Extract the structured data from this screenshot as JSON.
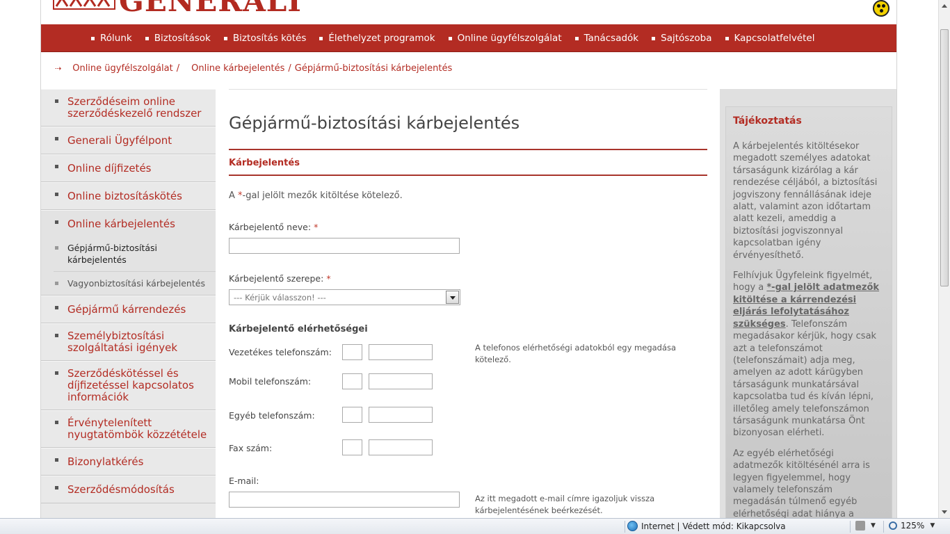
{
  "header": {
    "logo_text": "GENERALI",
    "accessibility_icon": "accessibility-icon"
  },
  "topnav": {
    "items": [
      {
        "label": "Rólunk"
      },
      {
        "label": "Biztosítások"
      },
      {
        "label": "Biztosítás kötés"
      },
      {
        "label": "Élethelyzet programok"
      },
      {
        "label": "Online ügyfélszolgálat"
      },
      {
        "label": "Tanácsadók"
      },
      {
        "label": "Sajtószoba"
      },
      {
        "label": "Kapcsolatfelvétel"
      }
    ]
  },
  "breadcrumb": {
    "items": [
      "Online ügyfélszolgálat",
      "Online kárbejelentés",
      "Gépjármű-biztosítási kárbejelentés"
    ],
    "sep": "/"
  },
  "sidebar": {
    "items": [
      {
        "label": "Szerződéseim online szerződéskezelő rendszer"
      },
      {
        "label": "Generali Ügyfélpont"
      },
      {
        "label": "Online díjfizetés"
      },
      {
        "label": "Online biztosításkötés"
      },
      {
        "label": "Online kárbejelentés"
      },
      {
        "label": "Gépjármű kárrendezés"
      },
      {
        "label": "Személybiztosítási szolgáltatási igények"
      },
      {
        "label": "Szerződéskötéssel és díjfizetéssel kapcsolatos információk"
      },
      {
        "label": "Érvénytelenített nyugtatömbök közzététele"
      },
      {
        "label": "Bizonylatkérés"
      },
      {
        "label": "Szerződésmódosítás"
      }
    ],
    "sub_items": [
      {
        "label": "Gépjármű-biztosítási kárbejelentés"
      },
      {
        "label": "Vagyonbiztosítási kárbejelentés"
      }
    ]
  },
  "main": {
    "title": "Gépjármű-biztosítási kárbejelentés",
    "section_title": "Kárbejelentés",
    "required_note_prefix": "A ",
    "required_note_star": "*",
    "required_note_suffix": "-gal jelölt mezők kitöltése kötelező.",
    "name_label": "Kárbejelentő neve:",
    "role_label": "Kárbejelentő szerepe:",
    "required_star": "*",
    "role_select_value": "--- Kérjük válasszon! ---",
    "contact_heading": "Kárbejelentő elérhetőségei",
    "phone_labels": {
      "landline": "Vezetékes telefonszám:",
      "mobile": "Mobil telefonszám:",
      "other": "Egyéb telefonszám:",
      "fax": "Fax szám:"
    },
    "phone_hint": "A telefonos elérhetőségi adatokból egy megadása kötelező.",
    "email_label": "E-mail:",
    "email_hint": "Az itt megadott e-mail címre igazoljuk vissza kárbejelentésének beérkezését."
  },
  "info": {
    "title": "Tájékoztatás",
    "p1": "A kárbejelentés kitöltésekor megadott személyes adatokat társaságunk kizárólag a kár rendezése céljából, a biztosítási jogviszony fennállásának ideje alatt, valamint azon időtartam alatt kezeli, ameddig a biztosítási jogviszonnyal kapcsolatban igény érvényesíthető.",
    "p2_a": "Felhívjuk Ügyfeleink figyelmét, hogy a ",
    "p2_bold": "*-gal jelölt adatmezők kitöltése a kárrendezési eljárás lefolytatásához szükséges",
    "p2_b": ". Telefonszám megadásakor kérjük, hogy csak azt a telefonszámot (telefonszámait) adja meg, amelyen az adott kárügyben társaságunk munkatársával kapcsolatba tud és kíván lépni, illetőleg amely telefonszámon társaságunk munkatársa Önt bizonyosan elérheti.",
    "p3": "Az egyéb elérhetőségi adatmezők kitöltésénél arra is legyen figyelemmel, hogy valamely telefonszám megadásán túlmenő egyéb elérhetőségi adat hiánya a"
  },
  "statusbar": {
    "zone": "Internet | Védett mód: Kikapcsolva",
    "zoom": "125%"
  },
  "colors": {
    "brand_red": "#b32c23",
    "sidebar_bg": "#e9e9e9",
    "info_bg": "#d0d0d0"
  }
}
